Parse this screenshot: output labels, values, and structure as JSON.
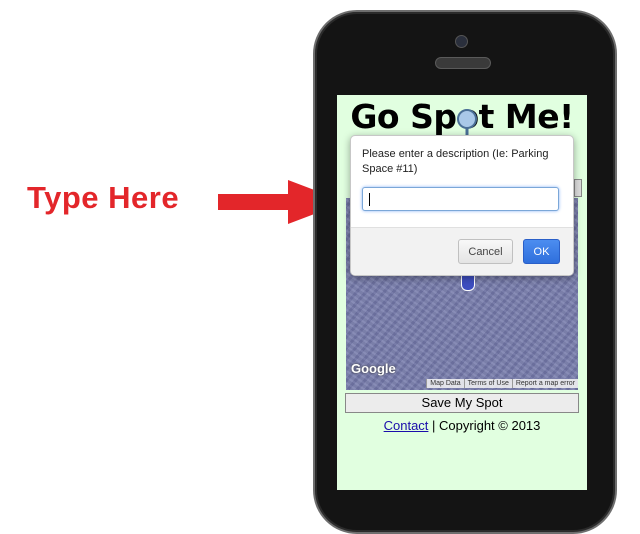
{
  "annotation": {
    "text": "Type Here"
  },
  "app": {
    "title": "Go Spot Me!",
    "save_button": "Save My Spot",
    "footer": {
      "contact_link": "Contact",
      "separator": " | ",
      "copyright": "Copyright © 2013"
    }
  },
  "map": {
    "logo": "Google",
    "links": [
      "Map Data",
      "Terms of Use",
      "Report a map error"
    ]
  },
  "dialog": {
    "message": "Please enter a description (Ie: Parking Space #11)",
    "input_value": "",
    "cancel_label": "Cancel",
    "ok_label": "OK"
  },
  "colors": {
    "annotation": "#e3262a",
    "screen_bg": "#e1ffe0",
    "ok_button": "#2f6fdc"
  }
}
